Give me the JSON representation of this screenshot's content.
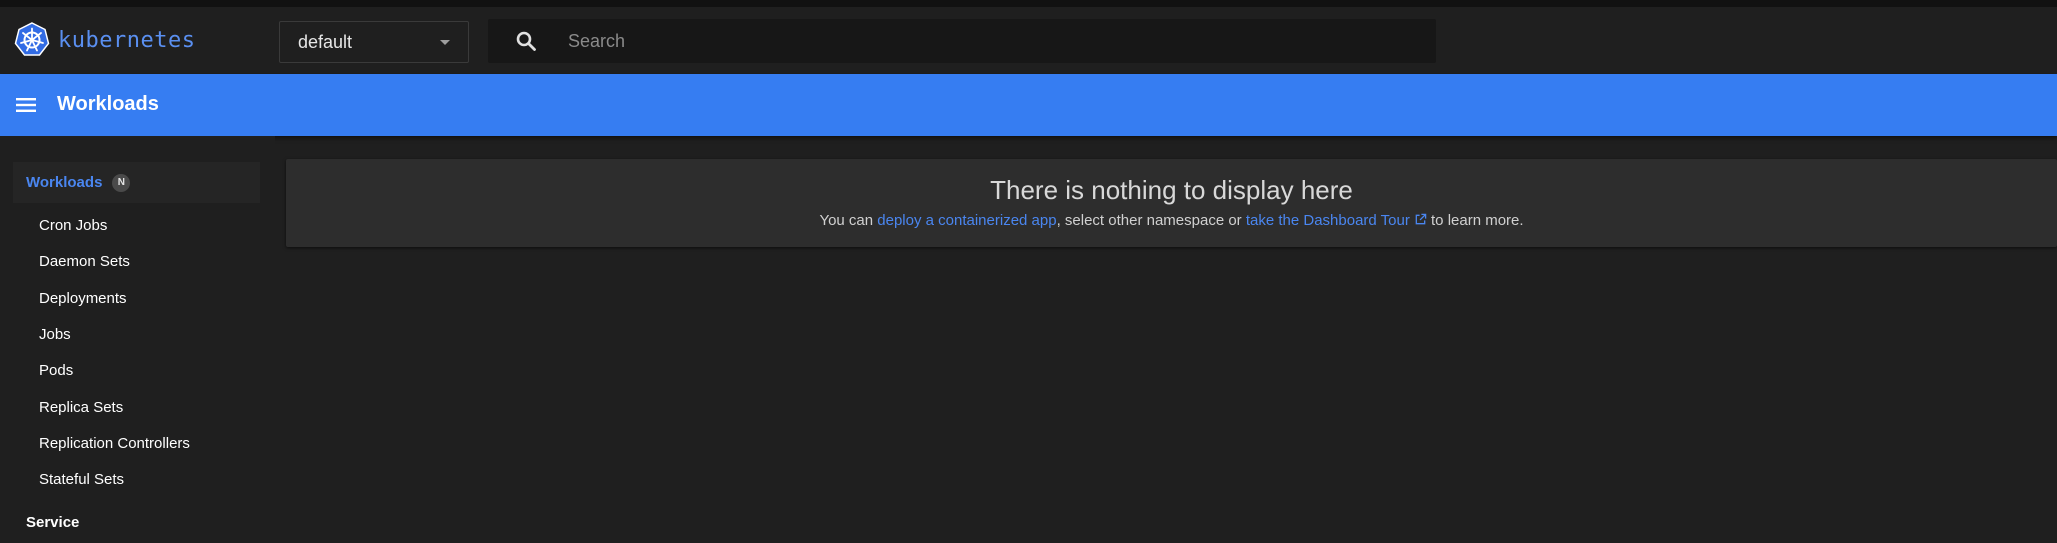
{
  "app": {
    "logo_text": "kubernetes",
    "logo_icon": "kubernetes-helm-wheel-icon",
    "accent_color": "#367df2"
  },
  "toolbar": {
    "namespace": {
      "selected": "default"
    },
    "search": {
      "placeholder": "Search",
      "value": ""
    }
  },
  "appbar": {
    "title": "Workloads",
    "menu_icon": "menu-icon"
  },
  "sidebar": {
    "section": {
      "label": "Workloads",
      "badge": "N"
    },
    "items": [
      {
        "label": "Cron Jobs"
      },
      {
        "label": "Daemon Sets"
      },
      {
        "label": "Deployments"
      },
      {
        "label": "Jobs"
      },
      {
        "label": "Pods"
      },
      {
        "label": "Replica Sets"
      },
      {
        "label": "Replication Controllers"
      },
      {
        "label": "Stateful Sets"
      }
    ],
    "next_group": {
      "label": "Service"
    }
  },
  "main": {
    "empty": {
      "title": "There is nothing to display here",
      "text_prefix": "You can ",
      "deploy_link": "deploy a containerized app",
      "text_middle": ", select other namespace or ",
      "tour_link": "take the Dashboard Tour",
      "text_suffix": " to learn more."
    }
  }
}
